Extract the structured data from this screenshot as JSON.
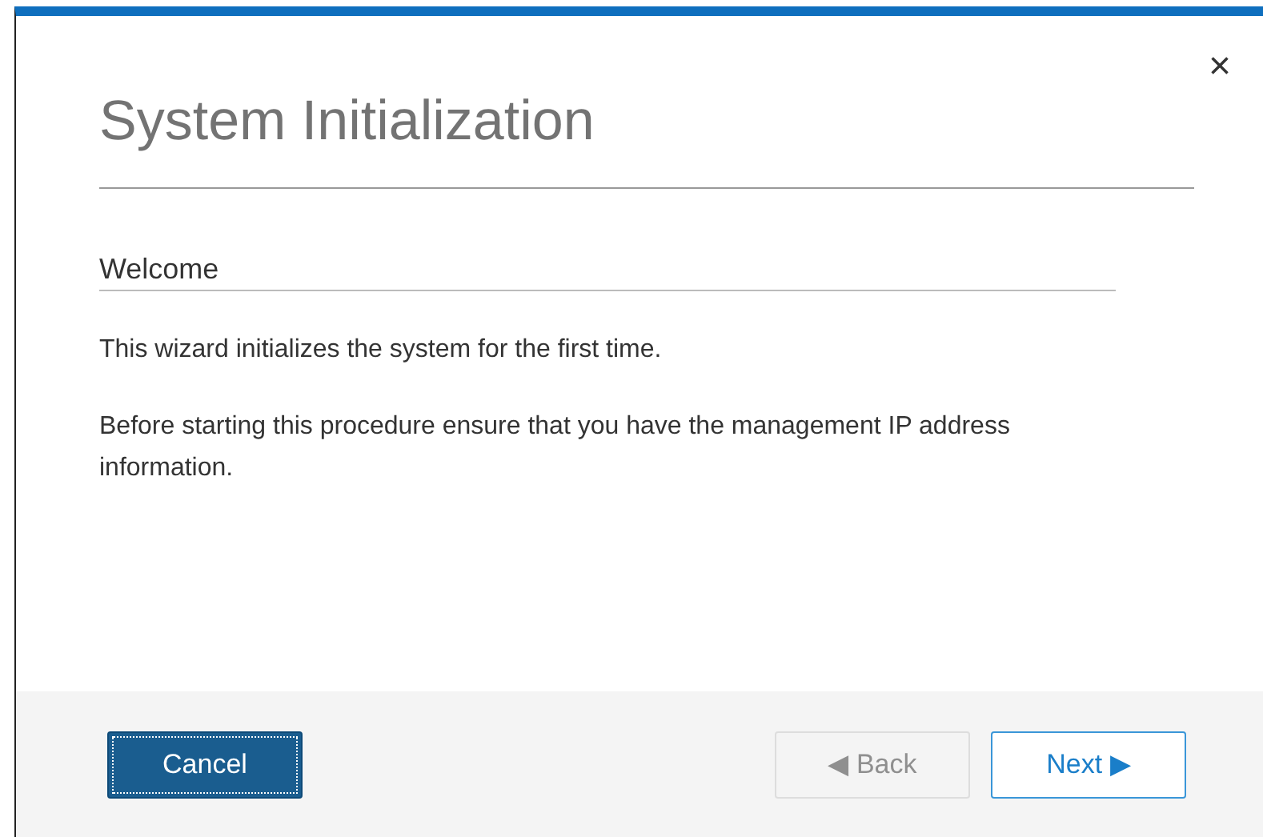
{
  "dialog": {
    "title": "System Initialization",
    "close": "×"
  },
  "section": {
    "heading": "Welcome"
  },
  "paragraphs": [
    "This wizard initializes the system for the first time.",
    "Before starting this procedure ensure that you have the management IP address information."
  ],
  "buttons": [
    {
      "label": "Cancel",
      "kind": "primary",
      "disabled": false,
      "focused": true
    },
    {
      "label": "◀ Back",
      "kind": "secondary",
      "disabled": true,
      "focused": false
    },
    {
      "label": "Next ▶",
      "kind": "secondary",
      "disabled": false,
      "focused": false
    }
  ]
}
